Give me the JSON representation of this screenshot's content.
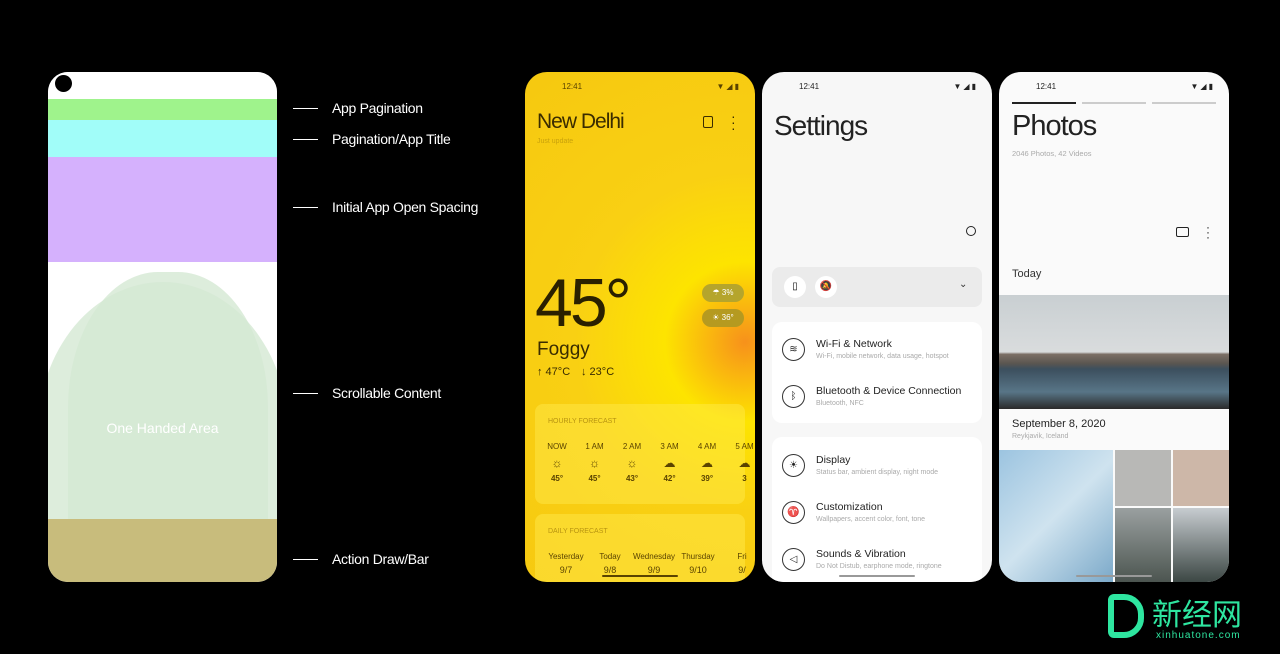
{
  "wireframe": {
    "one_handed_label": "One Handed Area",
    "colors": {
      "pagination": "#9ff38c",
      "title": "#a1fdf9",
      "spacing": "#d5b1fd",
      "content": "#d5e8d3",
      "action": "#c8bc7c"
    }
  },
  "labels": [
    "App Pagination",
    "Pagination/App Title",
    "Initial App Open Spacing",
    "Scrollable Content",
    "Action Draw/Bar"
  ],
  "weather": {
    "time": "12:41",
    "city": "New Delhi",
    "subtitle": "Just update",
    "temp": "45°",
    "condition": "Foggy",
    "high": "↑ 47°C",
    "low": "↓ 23°C",
    "rain_chip": "3%",
    "uv_chip": "36°",
    "hourly_title": "HOURLY FORECAST",
    "hourly": [
      {
        "t": "NOW",
        "icon": "sun-icon",
        "v": "45°"
      },
      {
        "t": "1 AM",
        "icon": "sun-icon",
        "v": "45°"
      },
      {
        "t": "2 AM",
        "icon": "sun-icon",
        "v": "43°"
      },
      {
        "t": "3 AM",
        "icon": "cloud-icon",
        "v": "42°"
      },
      {
        "t": "4 AM",
        "icon": "cloud-icon",
        "v": "39°"
      },
      {
        "t": "5 AM",
        "icon": "cloud-icon",
        "v": "3"
      }
    ],
    "daily_title": "DAILY FORECAST",
    "daily": [
      {
        "d": "Yesterday",
        "n": "9/7"
      },
      {
        "d": "Today",
        "n": "9/8"
      },
      {
        "d": "Wednesday",
        "n": "9/9"
      },
      {
        "d": "Thursday",
        "n": "9/10"
      },
      {
        "d": "Fri",
        "n": "9/"
      }
    ]
  },
  "settings": {
    "time": "12:41",
    "title": "Settings",
    "items": [
      {
        "icon": "wifi-icon",
        "title": "Wi-Fi & Network",
        "sub": "Wi-Fi, mobile network, data usage, hotspot"
      },
      {
        "icon": "bluetooth-icon",
        "title": "Bluetooth & Device Connection",
        "sub": "Bluetooth, NFC"
      },
      {
        "icon": "display-icon",
        "title": "Display",
        "sub": "Status bar, ambient display, night mode"
      },
      {
        "icon": "shirt-icon",
        "title": "Customization",
        "sub": "Wallpapers, accent color, font, tone"
      },
      {
        "icon": "speaker-icon",
        "title": "Sounds & Vibration",
        "sub": "Do Not Distub, earphone mode, ringtone"
      }
    ]
  },
  "photos": {
    "time": "12:41",
    "title": "Photos",
    "count": "2046 Photos, 42 Videos",
    "section": "Today",
    "date": "September 8, 2020",
    "place": "Reykjavik, Iceland"
  },
  "watermark": {
    "cn": "新经网",
    "url": "xinhuatone.com",
    "color": "#2ee6a0"
  }
}
